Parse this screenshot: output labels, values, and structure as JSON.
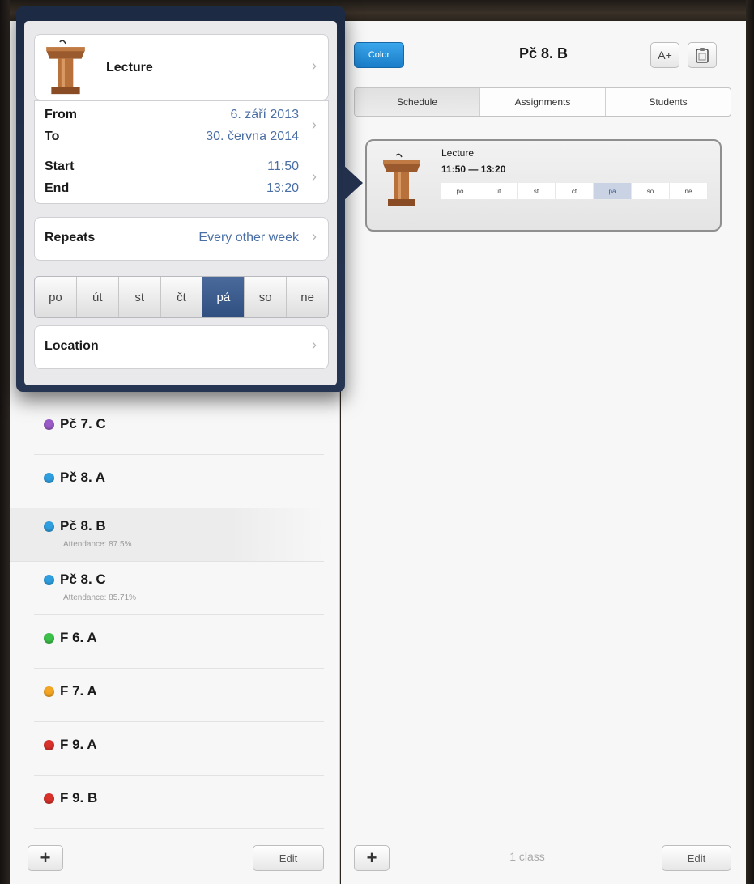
{
  "popover": {
    "event_type": "Lecture",
    "from_label": "From",
    "from_value": "6. září 2013",
    "to_label": "To",
    "to_value": "30. června 2014",
    "start_label": "Start",
    "start_value": "11:50",
    "end_label": "End",
    "end_value": "13:20",
    "repeats_label": "Repeats",
    "repeats_value": "Every other week",
    "days": [
      "po",
      "út",
      "st",
      "čt",
      "pá",
      "so",
      "ne"
    ],
    "selected_day": "pá",
    "location_label": "Location"
  },
  "class_list": [
    {
      "name": "Pč 7. C",
      "color": "#9b5cc9",
      "sub": ""
    },
    {
      "name": "Pč 8. A",
      "color": "#2f9fe0",
      "sub": ""
    },
    {
      "name": "Pč 8. B",
      "color": "#2f9fe0",
      "sub": "Attendance: 87.5%",
      "selected": true
    },
    {
      "name": "Pč 8. C",
      "color": "#2f9fe0",
      "sub": "Attendance: 85.71%"
    },
    {
      "name": "F 6. A",
      "color": "#3cc24a",
      "sub": ""
    },
    {
      "name": "F 7. A",
      "color": "#f5a623",
      "sub": ""
    },
    {
      "name": "F 9. A",
      "color": "#d9322b",
      "sub": ""
    },
    {
      "name": "F 9. B",
      "color": "#d9322b",
      "sub": ""
    }
  ],
  "left_footer": {
    "add_label": "+",
    "edit_label": "Edit"
  },
  "right": {
    "color_button": "Color",
    "title": "Pč 8. B",
    "font_button": "A+",
    "tabs": [
      "Schedule",
      "Assignments",
      "Students"
    ],
    "active_tab": "Schedule",
    "card": {
      "title": "Lecture",
      "time": "11:50 — 13:20",
      "days": [
        "po",
        "út",
        "st",
        "čt",
        "pá",
        "so",
        "ne"
      ],
      "selected_day": "pá"
    },
    "footer": {
      "add_label": "+",
      "count_label": "1 class",
      "edit_label": "Edit"
    }
  },
  "icons": {
    "lectern": "lectern-icon",
    "clipboard": "clipboard-icon",
    "chevron": "chevron-right-icon"
  }
}
